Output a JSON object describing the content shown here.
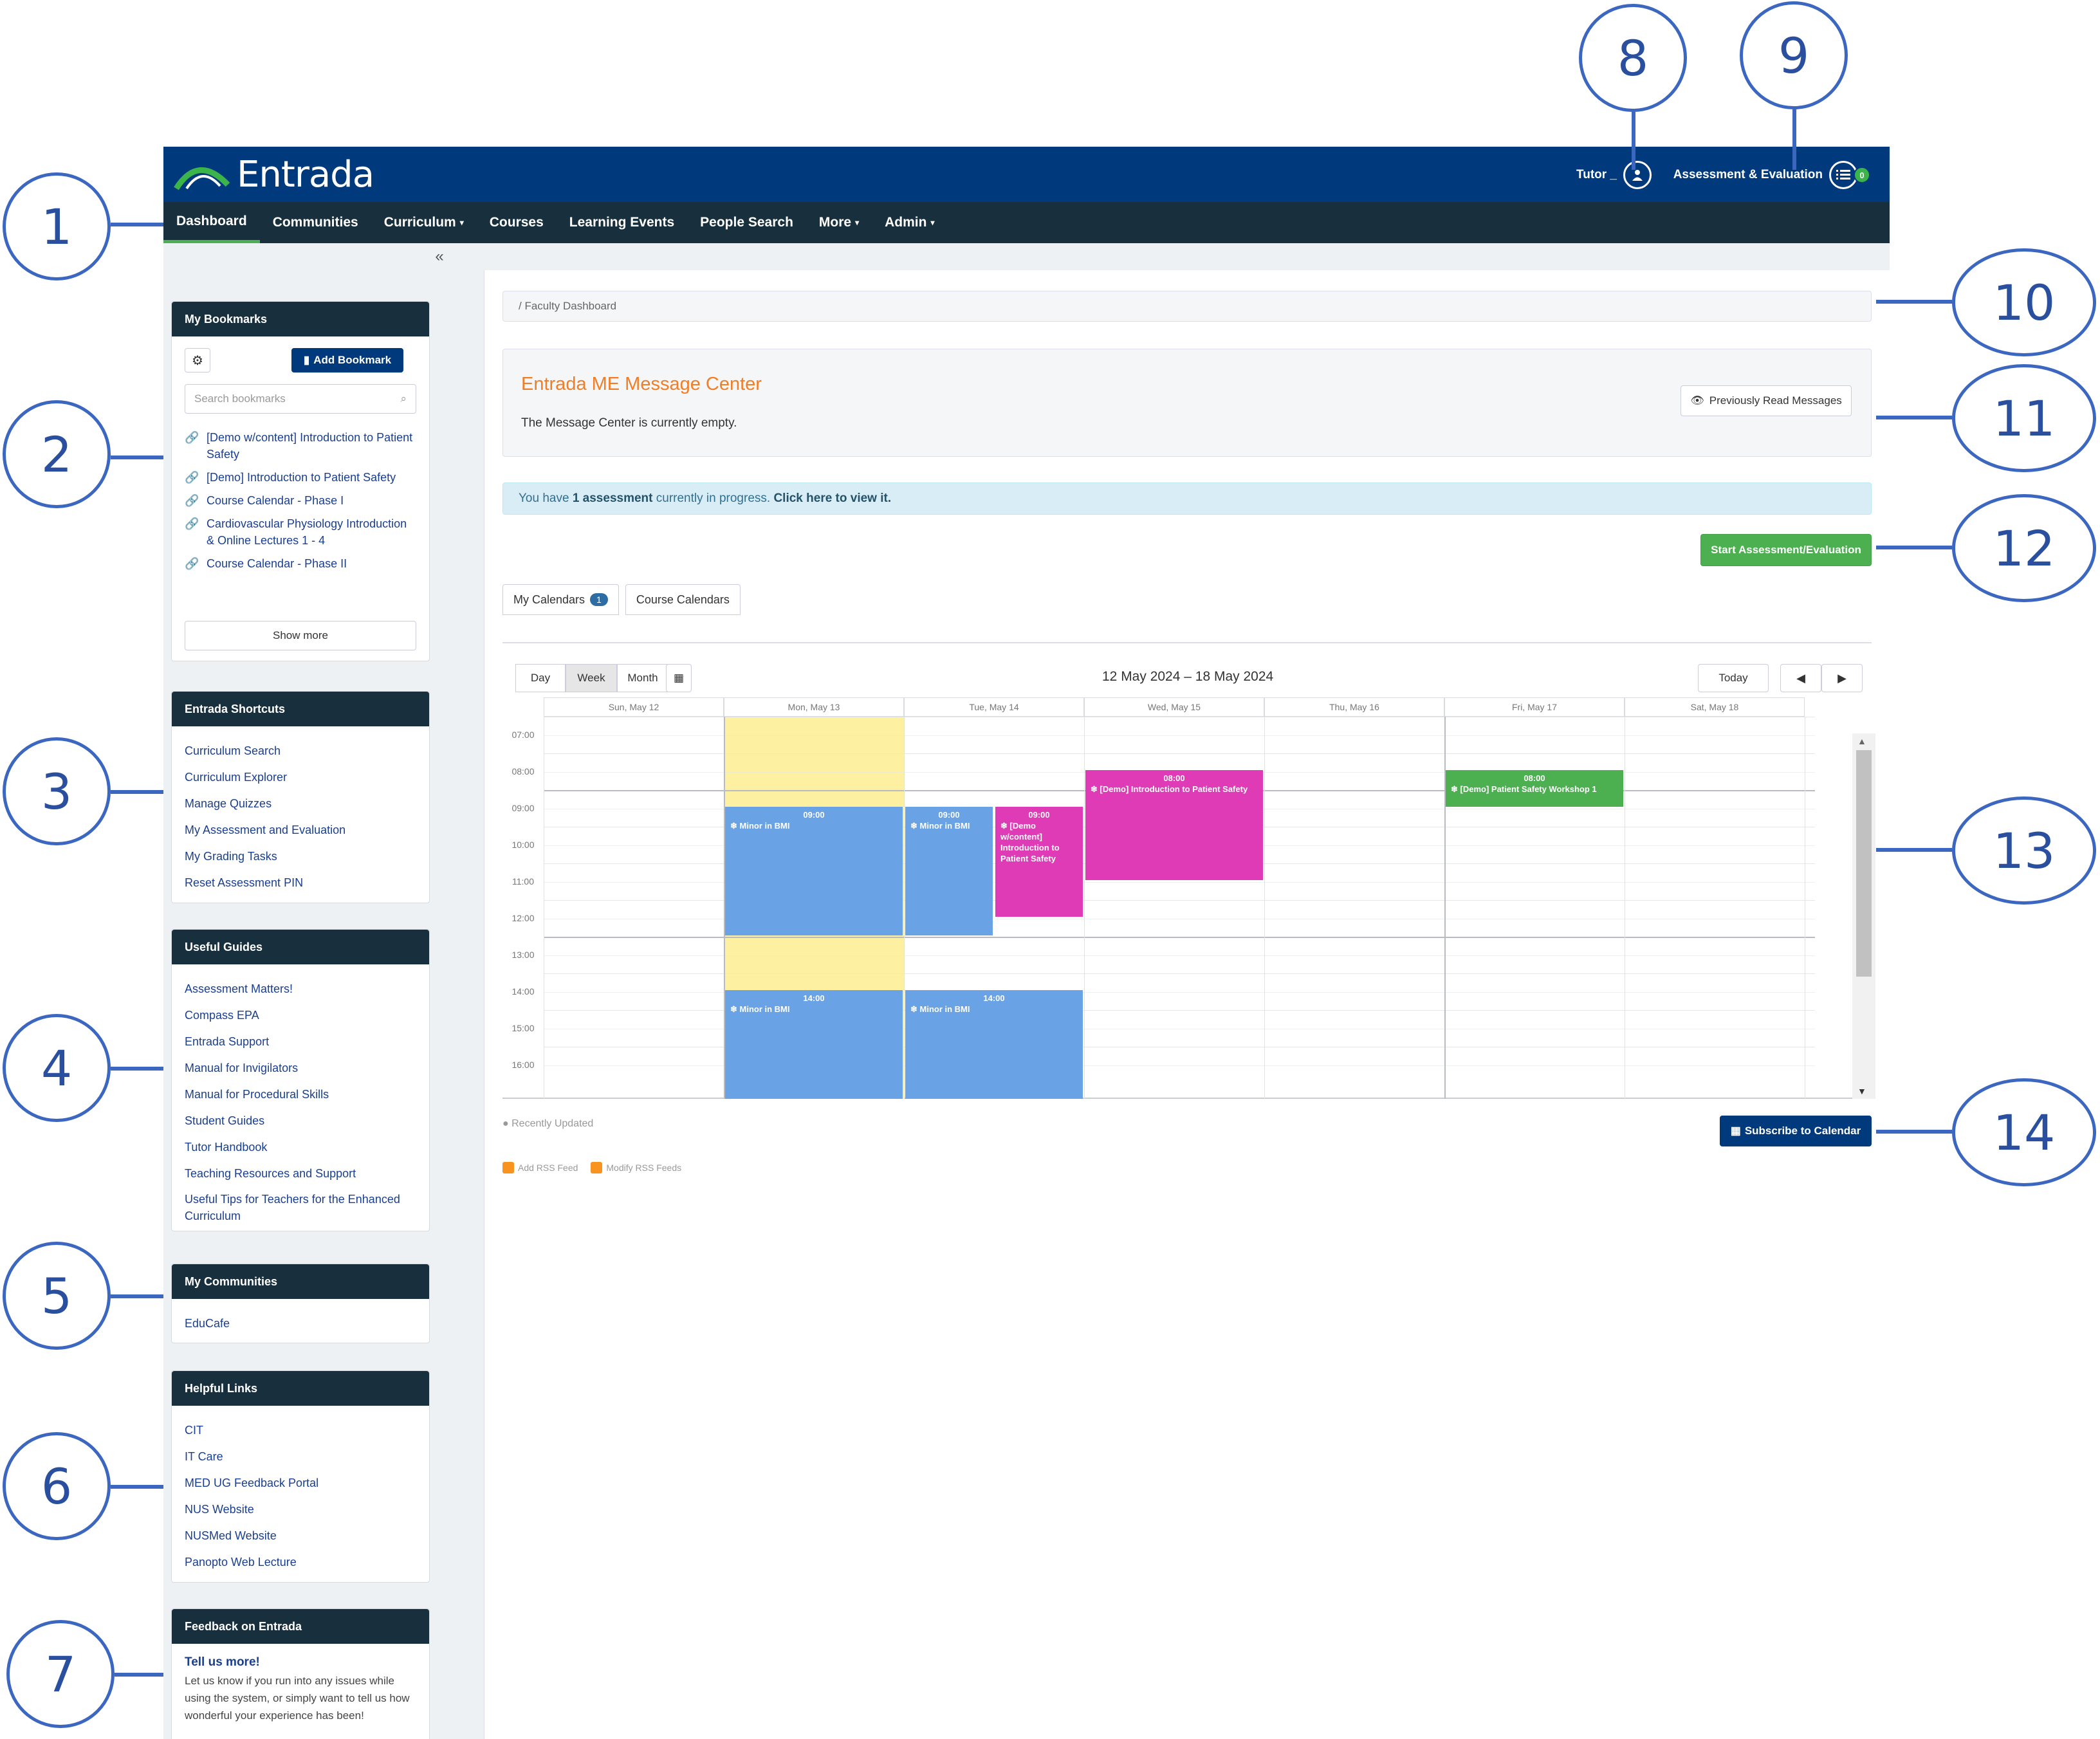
{
  "brand": {
    "name": "Entrada"
  },
  "topbar": {
    "user_label": "Tutor _",
    "ae_label": "Assessment & Evaluation",
    "ae_count": "0"
  },
  "nav": {
    "items": [
      {
        "label": "Dashboard",
        "active": true,
        "caret": false
      },
      {
        "label": "Communities",
        "caret": false
      },
      {
        "label": "Curriculum",
        "caret": true
      },
      {
        "label": "Courses",
        "caret": false
      },
      {
        "label": "Learning Events",
        "caret": false
      },
      {
        "label": "People Search",
        "caret": false
      },
      {
        "label": "More",
        "caret": true
      },
      {
        "label": "Admin",
        "caret": true
      }
    ]
  },
  "sidebar": {
    "collapse": "«",
    "bookmarks": {
      "title": "My Bookmarks",
      "add_label": "Add Bookmark",
      "search_placeholder": "Search bookmarks",
      "items": [
        "[Demo w/content] Introduction to Patient Safety",
        "[Demo] Introduction to Patient Safety",
        "Course Calendar - Phase I",
        "Cardiovascular Physiology Introduction & Online Lectures 1 - 4",
        "Course Calendar - Phase II"
      ],
      "show_more": "Show more"
    },
    "shortcuts": {
      "title": "Entrada Shortcuts",
      "items": [
        "Curriculum Search",
        "Curriculum Explorer",
        "Manage Quizzes",
        "My Assessment and Evaluation",
        "My Grading Tasks",
        "Reset Assessment PIN"
      ]
    },
    "guides": {
      "title": "Useful Guides",
      "items": [
        "Assessment Matters!",
        "Compass EPA",
        "Entrada Support",
        "Manual for Invigilators",
        "Manual for Procedural Skills",
        "Student Guides",
        "Tutor Handbook",
        "Teaching Resources and Support",
        "Useful Tips for Teachers for the Enhanced Curriculum"
      ]
    },
    "communities": {
      "title": "My Communities",
      "items": [
        "EduCafe"
      ]
    },
    "helpful": {
      "title": "Helpful Links",
      "items": [
        "CIT",
        "IT Care",
        "MED UG Feedback Portal",
        "NUS Website",
        "NUSMed Website",
        "Panopto Web Lecture"
      ]
    },
    "feedback": {
      "title": "Feedback on Entrada",
      "heading": "Tell us more!",
      "body": "Let us know if you run into any issues while using the system, or simply want to tell us how wonderful your experience has been!"
    }
  },
  "main": {
    "breadcrumb": "/   Faculty Dashboard",
    "message_center": {
      "title": "Entrada ME Message Center",
      "body": "The Message Center is currently empty.",
      "button": "Previously Read Messages"
    },
    "alert": {
      "pre": "You have ",
      "bold": "1 assessment",
      "mid": " currently in progress. ",
      "link": "Click here to view it."
    },
    "start_button": "Start Assessment/Evaluation",
    "tabs": [
      {
        "label": "My Calendars",
        "badge": "1"
      },
      {
        "label": "Course Calendars"
      }
    ],
    "calendar": {
      "views": [
        "Day",
        "Week",
        "Month"
      ],
      "active_view": "Week",
      "range": "12 May 2024 – 18 May 2024",
      "today": "Today",
      "days": [
        "Sun, May 12",
        "Mon, May 13",
        "Tue, May 14",
        "Wed, May 15",
        "Thu, May 16",
        "Fri, May 17",
        "Sat, May 18"
      ],
      "hours": [
        "07:00",
        "08:00",
        "09:00",
        "10:00",
        "11:00",
        "12:00",
        "13:00",
        "14:00",
        "15:00",
        "16:00"
      ],
      "events": [
        {
          "time": "09:00",
          "title": "❄ Minor in BMI",
          "color": "#6aa2e6"
        },
        {
          "time": "09:00",
          "title": "❄ Minor in BMI",
          "color": "#6aa2e6"
        },
        {
          "time": "09:00",
          "title": "❄ [Demo w/content] Introduction to Patient Safety",
          "color": "#e03bb6"
        },
        {
          "time": "08:00",
          "title": "❄ [Demo] Introduction to Patient Safety",
          "color": "#e03bb6"
        },
        {
          "time": "08:00",
          "title": "❄ [Demo] Patient Safety Workshop 1",
          "color": "#4caf50"
        },
        {
          "time": "14:00",
          "title": "❄ Minor in BMI",
          "color": "#6aa2e6"
        },
        {
          "time": "14:00",
          "title": "❄ Minor in BMI",
          "color": "#6aa2e6"
        }
      ],
      "highlight_color": "#fdf0a0"
    },
    "recently_updated": "Recently Updated",
    "subscribe": "Subscribe to Calendar",
    "rss": [
      "Add RSS Feed",
      "Modify RSS Feeds"
    ]
  },
  "callouts": [
    "1",
    "2",
    "3",
    "4",
    "5",
    "6",
    "7",
    "8",
    "9",
    "10",
    "11",
    "12",
    "13",
    "14"
  ],
  "colors": {
    "topbar": "#003a7d",
    "navbar": "#18303d",
    "accent_orange": "#f07e26",
    "callout": "#3c67c0"
  }
}
